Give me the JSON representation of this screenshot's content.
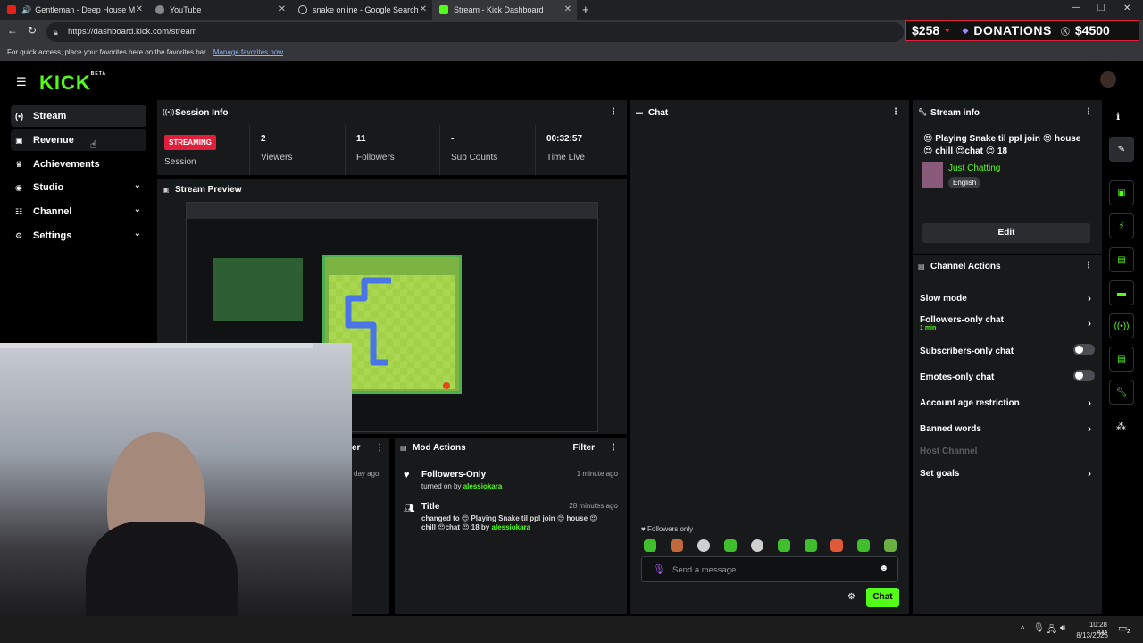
{
  "browser": {
    "tabs": [
      {
        "label": "Gentleman - Deep House M",
        "color": "#e62117"
      },
      {
        "label": "YouTube",
        "color": "#888888"
      },
      {
        "label": "snake online - Google Search",
        "color": "#cccccc"
      },
      {
        "label": "Stream - Kick Dashboard",
        "color": "#53fc18"
      }
    ],
    "url": "https://dashboard.kick.com/stream",
    "fav_text": "For quick access, place your favorites here on the favorites bar.",
    "fav_link": "Manage favorites now"
  },
  "donations": {
    "left": "$258",
    "label": "DONATIONS",
    "right": "$4500"
  },
  "app": {
    "logo": "KICK",
    "logo_badge": "BETA",
    "sidebar": [
      {
        "label": "Stream",
        "icon": "broadcast-icon",
        "glyph": "(•)",
        "expandable": false
      },
      {
        "label": "Revenue",
        "icon": "chart-icon",
        "glyph": "▣",
        "expandable": false
      },
      {
        "label": "Achievements",
        "icon": "trophy-icon",
        "glyph": "♛",
        "expandable": false
      },
      {
        "label": "Studio",
        "icon": "studio-icon",
        "glyph": "◉",
        "expandable": true
      },
      {
        "label": "Channel",
        "icon": "channel-icon",
        "glyph": "☷",
        "expandable": true
      },
      {
        "label": "Settings",
        "icon": "gear-icon",
        "glyph": "⚙",
        "expandable": true
      }
    ],
    "session": {
      "title": "Session Info",
      "status": "STREAMING",
      "status_label": "Session",
      "stats": [
        {
          "value": "2",
          "label": "Viewers"
        },
        {
          "value": "11",
          "label": "Followers"
        },
        {
          "value": "-",
          "label": "Sub Counts"
        },
        {
          "value": "00:32:57",
          "label": "Time Live"
        }
      ]
    },
    "preview_title": "Stream Preview",
    "chat": {
      "title": "Chat",
      "followers_only": "Followers only",
      "placeholder": "Send a message",
      "send": "Chat"
    },
    "stream_info": {
      "title": "Stream info",
      "stream_title": "😍 Playing Snake til ppl join 😍 house 😍 chill 😍chat 😍 18",
      "category": "Just Chatting",
      "language": "English",
      "edit": "Edit"
    },
    "channel_actions": {
      "title": "Channel Actions",
      "items": [
        {
          "label": "Slow mode",
          "kind": "arrow"
        },
        {
          "label": "Followers-only chat",
          "sub": "1 min",
          "kind": "arrow"
        },
        {
          "label": "Subscribers-only chat",
          "kind": "toggle"
        },
        {
          "label": "Emotes-only chat",
          "kind": "toggle"
        },
        {
          "label": "Account age restriction",
          "kind": "arrow"
        },
        {
          "label": "Banned words",
          "kind": "arrow"
        },
        {
          "label": "Host Channel",
          "kind": "disabled"
        },
        {
          "label": "Set goals",
          "kind": "arrow"
        }
      ]
    },
    "mod": {
      "title": "Mod Actions",
      "filter": "Filter",
      "partial_title": "er",
      "partial_time": "day ago",
      "items": [
        {
          "title": "Followers-Only",
          "time": "1 minute ago",
          "desc": "turned on by",
          "user": "alessiokara"
        },
        {
          "title": "Title",
          "time": "28 minutes ago",
          "desc": "changed to 😍 Playing Snake til ppl join 😍 house 😍 chill 😍chat 😍 18 by",
          "user": "alessiokara"
        }
      ]
    }
  },
  "taskbar": {
    "time": "10:28 AM",
    "date": "8/13/2025",
    "notif": "2"
  }
}
